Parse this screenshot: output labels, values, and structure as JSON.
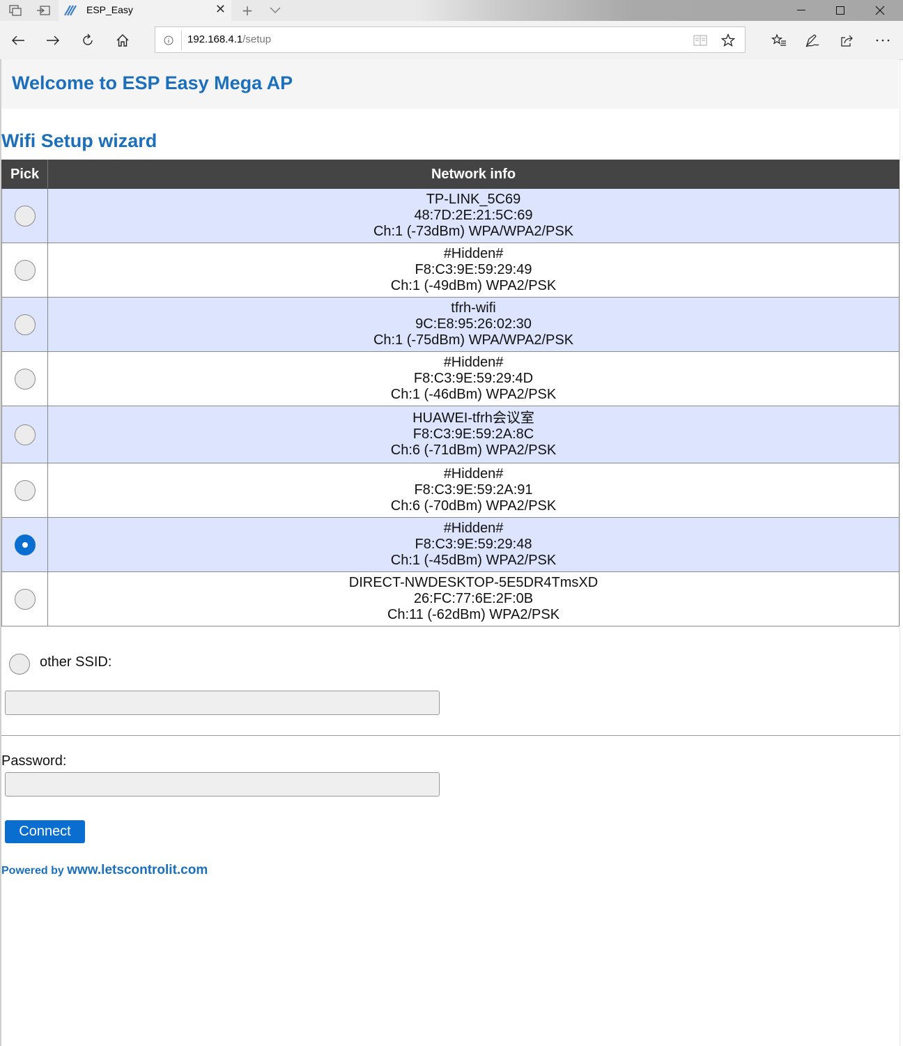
{
  "browser": {
    "tab_title": "ESP_Easy",
    "url_host": "192.168.4.1",
    "url_path": "/setup"
  },
  "page": {
    "heading": "Welcome to ESP Easy Mega AP",
    "subheading": "Wifi Setup wizard",
    "table": {
      "headers": {
        "pick": "Pick",
        "info": "Network info"
      },
      "networks": [
        {
          "ssid": "TP-LINK_5C69",
          "bssid": "48:7D:2E:21:5C:69",
          "details": "Ch:1 (-73dBm) WPA/WPA2/PSK",
          "selected": false
        },
        {
          "ssid": "#Hidden#",
          "bssid": "F8:C3:9E:59:29:49",
          "details": "Ch:1 (-49dBm) WPA2/PSK",
          "selected": false
        },
        {
          "ssid": "tfrh-wifi",
          "bssid": "9C:E8:95:26:02:30",
          "details": "Ch:1 (-75dBm) WPA/WPA2/PSK",
          "selected": false
        },
        {
          "ssid": "#Hidden#",
          "bssid": "F8:C3:9E:59:29:4D",
          "details": "Ch:1 (-46dBm) WPA2/PSK",
          "selected": false
        },
        {
          "ssid": "HUAWEI-tfrh会议室",
          "bssid": "F8:C3:9E:59:2A:8C",
          "details": "Ch:6 (-71dBm) WPA2/PSK",
          "selected": false
        },
        {
          "ssid": "#Hidden#",
          "bssid": "F8:C3:9E:59:2A:91",
          "details": "Ch:6 (-70dBm) WPA2/PSK",
          "selected": false
        },
        {
          "ssid": "#Hidden#",
          "bssid": "F8:C3:9E:59:29:48",
          "details": "Ch:1 (-45dBm) WPA2/PSK",
          "selected": true
        },
        {
          "ssid": "DIRECT-NWDESKTOP-5E5DR4TmsXD",
          "bssid": "26:FC:77:6E:2F:0B",
          "details": "Ch:11 (-62dBm) WPA2/PSK",
          "selected": false
        }
      ]
    },
    "other_ssid_label": "other SSID:",
    "other_ssid_value": "",
    "password_label": "Password:",
    "password_value": "",
    "connect_label": "Connect",
    "footer_prefix": "Powered by",
    "footer_link": "www.letscontrolit.com"
  },
  "colors": {
    "accent": "#1b6fbb",
    "button": "#0a6ed1",
    "row_alt": "#dde4fd",
    "header_bg": "#444444"
  }
}
